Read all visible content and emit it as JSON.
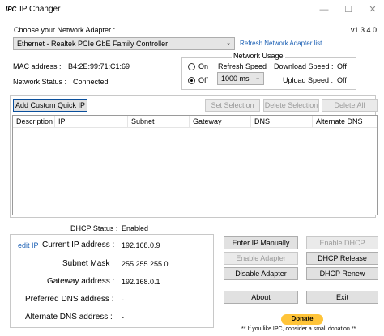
{
  "window": {
    "app_icon": "IPC",
    "title": "IP Changer",
    "controls": [
      "—",
      "☐",
      "✕"
    ]
  },
  "adapter": {
    "label": "Choose your Network Adapter :",
    "selected": "Ethernet  -  Realtek PCIe GbE Family Controller",
    "refresh_link": "Refresh Network Adapter list",
    "version": "v1.3.4.0"
  },
  "info": {
    "mac_label": "MAC address :",
    "mac_value": "B4:2E:99:71:C1:69",
    "status_label": "Network Status :",
    "status_value": "Connected"
  },
  "usage": {
    "title": "Network Usage",
    "on_label": "On",
    "off_label": "Off",
    "selected": "Off",
    "refresh_label": "Refresh Speed",
    "refresh_value": "1000 ms",
    "download_label": "Download Speed :",
    "download_value": "Off",
    "upload_label": "Upload Speed :",
    "upload_value": "Off"
  },
  "quick": {
    "add_button": "Add Custom Quick IP",
    "set_button": "Set Selection",
    "delete_button": "Delete Selection",
    "delete_all_button": "Delete All",
    "columns": [
      "Description",
      "IP",
      "Subnet",
      "Gateway",
      "DNS",
      "Alternate DNS"
    ]
  },
  "details": {
    "dhcp_label": "DHCP Status :",
    "dhcp_value": "Enabled",
    "edit_link": "edit IP",
    "ip_label": "Current IP address :",
    "ip_value": "192.168.0.9",
    "subnet_label": "Subnet Mask :",
    "subnet_value": "255.255.255.0",
    "gateway_label": "Gateway address :",
    "gateway_value": "192.168.0.1",
    "pref_dns_label": "Preferred DNS address :",
    "pref_dns_value": "-",
    "alt_dns_label": "Alternate DNS address :",
    "alt_dns_value": "-"
  },
  "actions": {
    "enter_manually": "Enter IP Manually",
    "enable_dhcp": "Enable DHCP",
    "enable_adapter": "Enable Adapter",
    "dhcp_release": "DHCP Release",
    "disable_adapter": "Disable Adapter",
    "dhcp_renew": "DHCP Renew",
    "about": "About",
    "exit": "Exit",
    "donate": "Donate",
    "donate_note": "** If you like IPC, consider a small donation **"
  },
  "colors": {
    "link": "#1a5fb4",
    "donate": "#ffc439"
  }
}
